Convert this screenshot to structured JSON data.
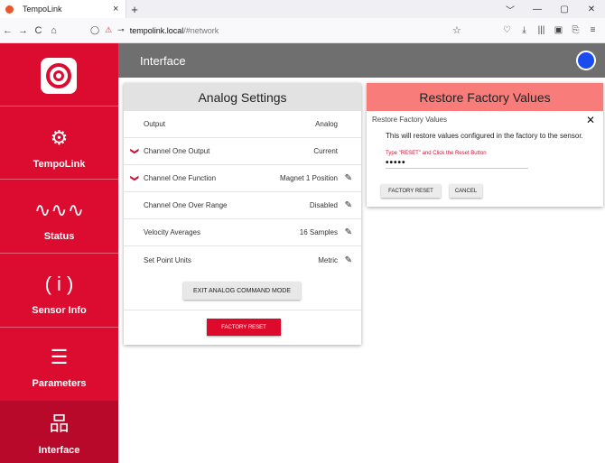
{
  "browser": {
    "tab_title": "TempoLink",
    "tab_close": "×",
    "new_tab": "+",
    "url_domain": "tempolink.local",
    "url_path": "/#network",
    "window_controls": [
      "﹀",
      "—",
      "▢",
      "✕"
    ],
    "nav": [
      "←",
      "→",
      "C",
      "⌂"
    ],
    "tools": [
      "♡",
      "⤓",
      "|||",
      "▣",
      "⎘",
      "≡"
    ],
    "star": "☆"
  },
  "sidebar": {
    "items": [
      {
        "label": "TempoLink",
        "icon": "gear-icon",
        "glyph": "⚙"
      },
      {
        "label": "Status",
        "icon": "waveform-icon",
        "glyph": "∿∿∿"
      },
      {
        "label": "Sensor Info",
        "icon": "info-icon",
        "glyph": "( i )"
      },
      {
        "label": "Parameters",
        "icon": "sliders-icon",
        "glyph": "☰"
      },
      {
        "label": "Interface",
        "icon": "network-icon",
        "glyph": "品"
      }
    ]
  },
  "header": {
    "title": "Interface",
    "status_color": "#1a4cf0"
  },
  "analog": {
    "title": "Analog Settings",
    "rows": [
      {
        "name": "Output",
        "value": "Analog"
      },
      {
        "name": "Channel One Output",
        "value": "Current"
      },
      {
        "name": "Channel One Function",
        "value": "Magnet 1 Position"
      },
      {
        "name": "Channel One Over Range",
        "value": "Disabled"
      },
      {
        "name": "Velocity Averages",
        "value": "16 Samples"
      },
      {
        "name": "Set Point Units",
        "value": "Metric"
      }
    ],
    "exit_label": "EXIT ANALOG COMMAND MODE",
    "factory_reset_label": "FACTORY RESET"
  },
  "restore": {
    "title": "Restore Factory Values",
    "dialog_title": "Restore Factory Values",
    "message": "This will restore values configured in the factory to the sensor.",
    "hint": "Type \"RESET\" and Click the Reset Button",
    "input_value": "•••••",
    "reset_label": "FACTORY RESET",
    "cancel_label": "CANCEL"
  },
  "colors": {
    "brand_red": "#db0c2f",
    "header_grey": "#6f6f6f",
    "restore_header": "#f87c7a"
  }
}
